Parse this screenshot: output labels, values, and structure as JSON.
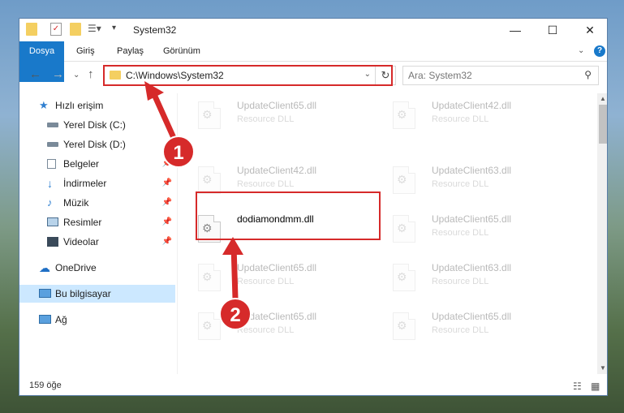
{
  "window": {
    "title": "System32",
    "controls": {
      "minimize": "—",
      "maximize": "☐",
      "close": "✕"
    }
  },
  "ribbon": {
    "tabs": [
      {
        "label": "Dosya"
      },
      {
        "label": "Giriş"
      },
      {
        "label": "Paylaş"
      },
      {
        "label": "Görünüm"
      }
    ],
    "help": "?"
  },
  "address": {
    "path": "C:\\Windows\\System32",
    "refresh": "↻"
  },
  "search": {
    "placeholder": "Ara: System32"
  },
  "sidebar": {
    "quick_access": "Hızlı erişim",
    "items": [
      {
        "label": "Yerel Disk (C:)"
      },
      {
        "label": "Yerel Disk (D:)"
      },
      {
        "label": "Belgeler"
      },
      {
        "label": "İndirmeler"
      },
      {
        "label": "Müzik"
      },
      {
        "label": "Resimler"
      },
      {
        "label": "Videolar"
      }
    ],
    "onedrive": "OneDrive",
    "this_pc": "Bu bilgisayar",
    "network": "Ağ"
  },
  "files": {
    "highlighted": {
      "name": "dodiamondmm.dll",
      "type": ""
    },
    "faded": [
      {
        "name": "UpdateClient65.dll",
        "type": "Resource DLL"
      },
      {
        "name": "UpdateClient42.dll",
        "type": "Resource DLL"
      },
      {
        "name": "UpdateClient42.dll",
        "type": "Resource DLL"
      },
      {
        "name": "UpdateClient63.dll",
        "type": "Resource DLL"
      },
      {
        "name": "UpdateClient65.dll",
        "type": "Resource DLL"
      },
      {
        "name": "UpdateClient65.dll",
        "type": "Resource DLL"
      },
      {
        "name": "UpdateClient63.dll",
        "type": "Resource DLL"
      },
      {
        "name": "UpdateClient65.dll",
        "type": "Resource DLL"
      },
      {
        "name": "UpdateClient65.dll",
        "type": "Resource DLL"
      }
    ]
  },
  "status": {
    "count": "159 öğe"
  },
  "annotations": {
    "step1": "1",
    "step2": "2"
  },
  "colors": {
    "accent": "#1979ca",
    "annotation": "#d62a2a",
    "selected": "#cce8ff"
  }
}
